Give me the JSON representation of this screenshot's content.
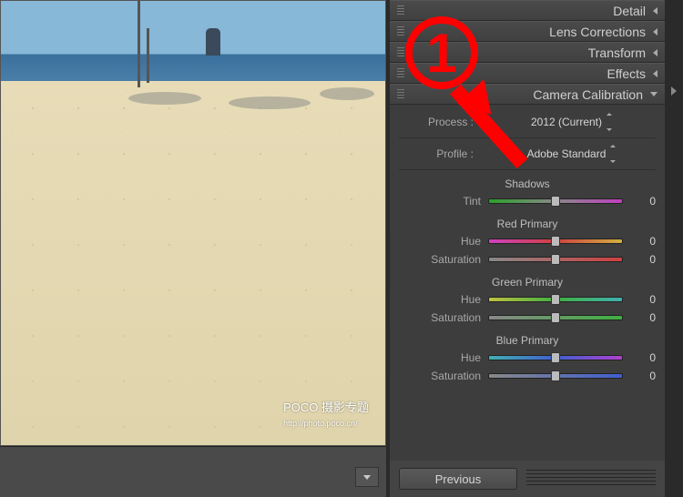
{
  "image": {
    "watermark_main": "POCO 摄影专题",
    "watermark_sub": "http://photo.poco.cn/"
  },
  "panels": [
    {
      "label": "Detail"
    },
    {
      "label": "Lens Corrections"
    },
    {
      "label": "Transform"
    },
    {
      "label": "Effects"
    },
    {
      "label": "Camera Calibration"
    }
  ],
  "calibration": {
    "process_label": "Process :",
    "process_value": "2012 (Current)",
    "profile_label": "Profile :",
    "profile_value": "Adobe Standard",
    "shadows": {
      "title": "Shadows",
      "tint_label": "Tint",
      "tint_value": "0"
    },
    "red": {
      "title": "Red Primary",
      "hue_label": "Hue",
      "hue_value": "0",
      "sat_label": "Saturation",
      "sat_value": "0"
    },
    "green": {
      "title": "Green Primary",
      "hue_label": "Hue",
      "hue_value": "0",
      "sat_label": "Saturation",
      "sat_value": "0"
    },
    "blue": {
      "title": "Blue Primary",
      "hue_label": "Hue",
      "hue_value": "0",
      "sat_label": "Saturation",
      "sat_value": "0"
    }
  },
  "footer": {
    "previous_label": "Previous"
  },
  "annotation": {
    "number": "1"
  }
}
